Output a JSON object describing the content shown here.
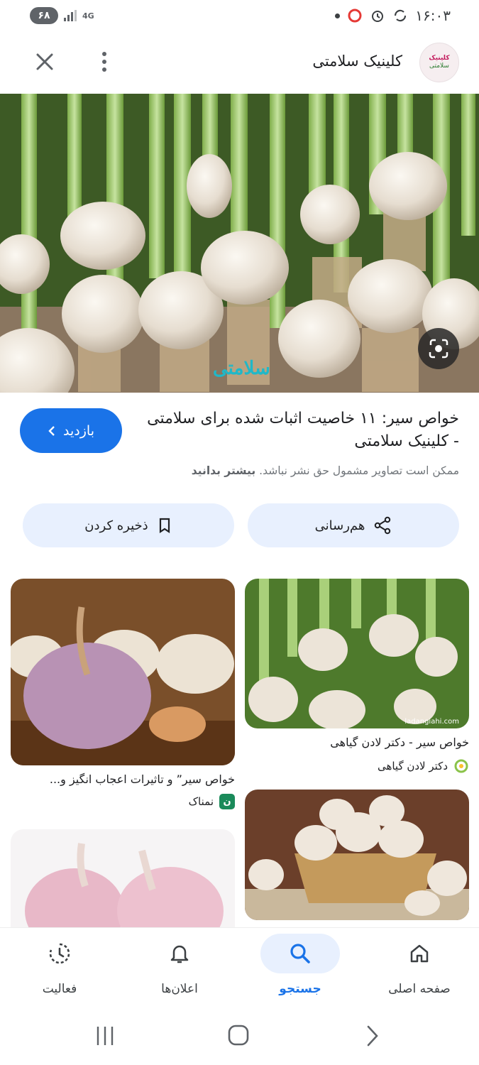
{
  "status_bar": {
    "time": "۱۶:۰۳",
    "battery": "۶۸",
    "network": "4G"
  },
  "header": {
    "site_name": "کلینیک سلامتی",
    "logo_line1": "کلینیک",
    "logo_line2": "سلامتی"
  },
  "hero": {
    "watermark": "سلامتی"
  },
  "result": {
    "title": "خواص سیر: ۱۱ خاصیت اثبات شده برای سلامتی - کلینیک سلامتی",
    "visit_label": "بازدید",
    "copyright_text": "ممکن است تصاویر مشمول حق نشر نباشد.",
    "learn_more": "بیشتر بدانید",
    "share_label": "هم‌رسانی",
    "save_label": "ذخیره کردن"
  },
  "related": [
    {
      "caption": "خواص سیر - دکتر لادن گیاهی",
      "source": "دکتر لادن گیاهی",
      "watermark": "ladangiahi.com"
    },
    {
      "caption": "خواص سیر” و تاثیرات اعجاب انگیز و...",
      "source": "نمناک"
    }
  ],
  "bottom_nav": {
    "home": "صفحه اصلی",
    "search": "جستجو",
    "notifications": "اعلان‌ها",
    "activity": "فعالیت"
  },
  "colors": {
    "accent": "#1a73e8",
    "pill_bg": "#e8f0fe"
  }
}
